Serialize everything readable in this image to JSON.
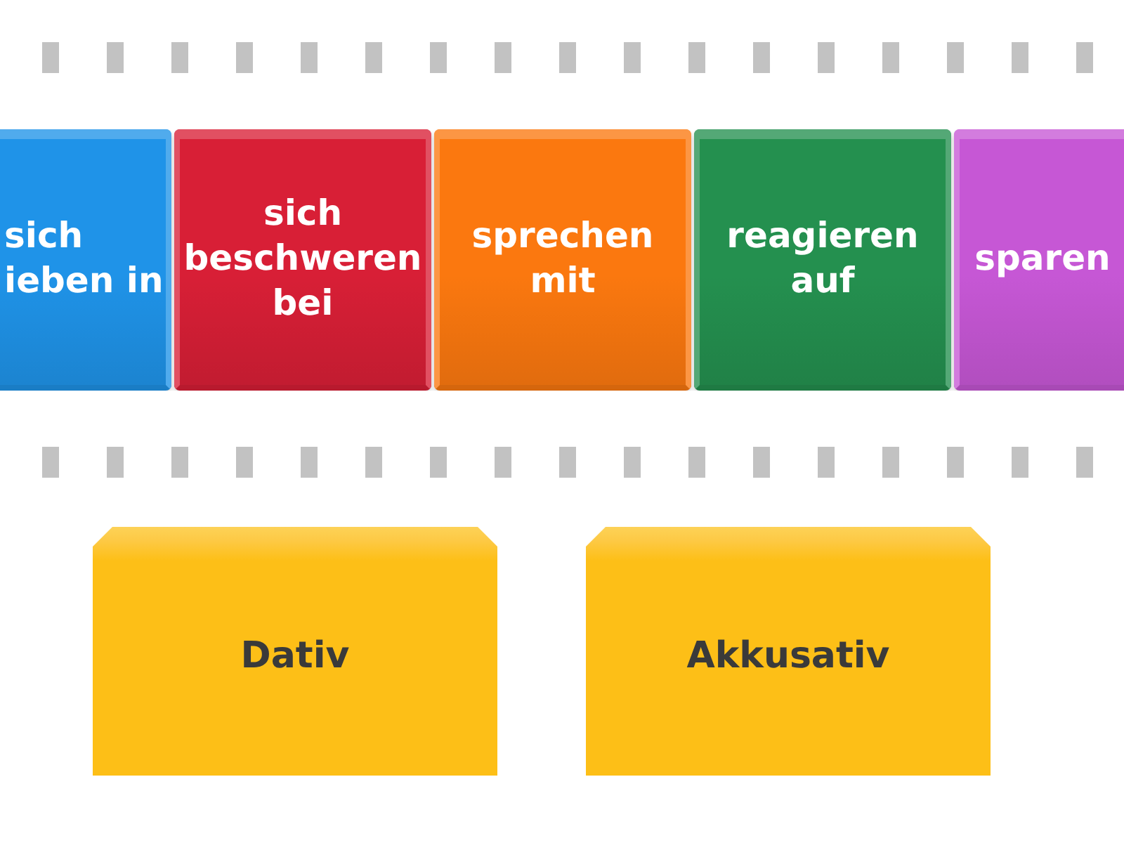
{
  "cards": [
    {
      "label": "sich ieben in",
      "color": "#1f93e8",
      "cut_at_left": true,
      "cut_at_right": false
    },
    {
      "label": "sich beschweren bei",
      "color": "#d81f36",
      "cut_at_left": false,
      "cut_at_right": false
    },
    {
      "label": "sprechen mit",
      "color": "#fb780f",
      "cut_at_left": false,
      "cut_at_right": false
    },
    {
      "label": "reagieren auf",
      "color": "#24904f",
      "cut_at_left": false,
      "cut_at_right": false
    },
    {
      "label": "sparen",
      "color": "#c657d5",
      "cut_at_left": false,
      "cut_at_right": true
    }
  ],
  "groups": [
    {
      "label": "Dativ"
    },
    {
      "label": "Akkusativ"
    }
  ]
}
